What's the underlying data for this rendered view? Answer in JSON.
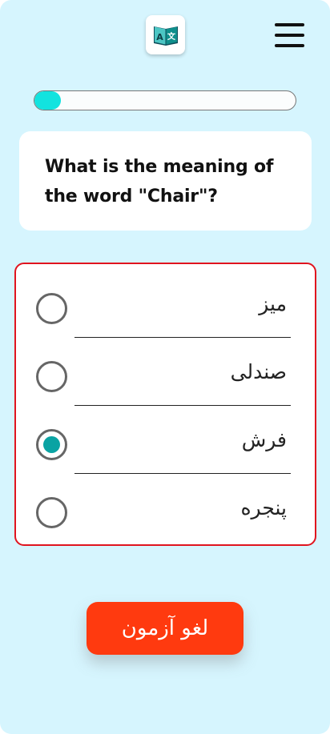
{
  "header": {
    "logo_icon": "translate-book-icon",
    "menu_icon": "hamburger-menu-icon"
  },
  "progress": {
    "fraction": 0.1,
    "color": "#12e3df"
  },
  "question": {
    "text": "What is the meaning of the word \"Chair\"?"
  },
  "options": [
    {
      "label": "میز",
      "selected": false
    },
    {
      "label": "صندلی",
      "selected": false
    },
    {
      "label": "فرش",
      "selected": true
    },
    {
      "label": "پنجره",
      "selected": false
    }
  ],
  "actions": {
    "cancel_label": "لغو آزمون"
  },
  "colors": {
    "background": "#d6f5fe",
    "accent": "#0aa3a3",
    "options_border": "#e0141f",
    "cancel_button": "#ff3a0f"
  }
}
